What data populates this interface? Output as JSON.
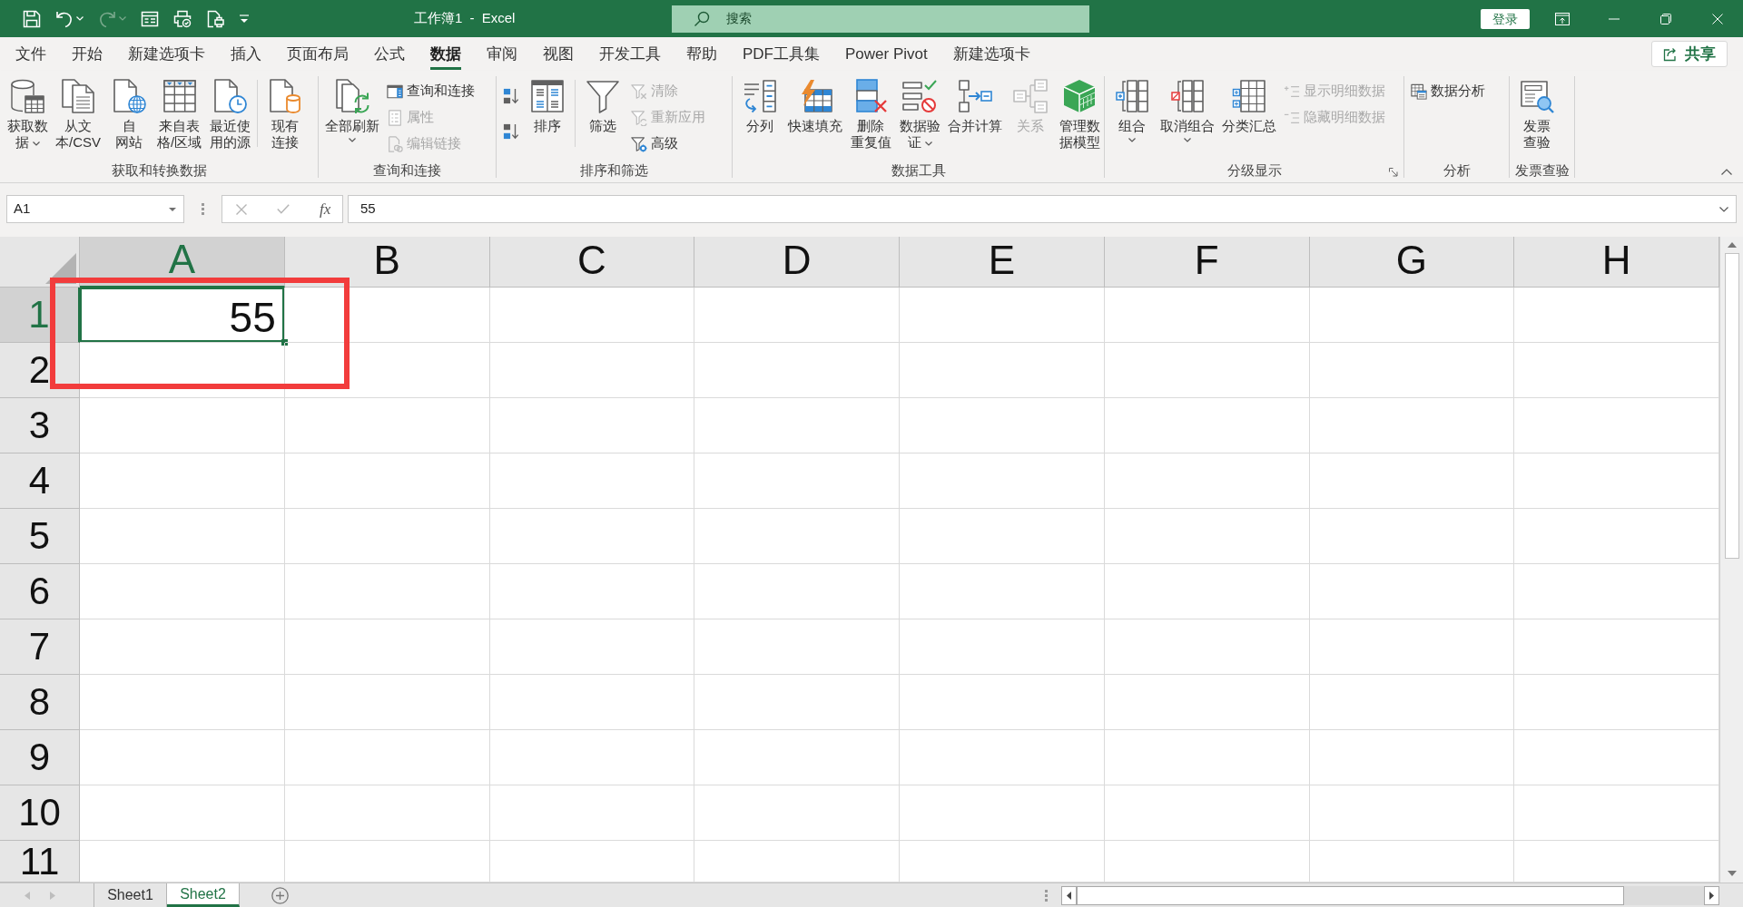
{
  "title_bar": {
    "quick_access": [
      {
        "kind": "save",
        "disabled": false
      },
      {
        "kind": "undo",
        "disabled": false,
        "dropdown": true
      },
      {
        "kind": "redo",
        "disabled": true,
        "dropdown": true
      },
      {
        "kind": "form",
        "disabled": false
      },
      {
        "kind": "print",
        "disabled": false
      },
      {
        "kind": "preview",
        "disabled": false
      },
      {
        "kind": "customize",
        "disabled": false
      }
    ],
    "title": "工作簿1 - Excel",
    "search": {
      "placeholder": "搜索"
    },
    "login_button": "登录"
  },
  "menu_tabs": [
    {
      "label": "文件",
      "selected": false
    },
    {
      "label": "开始",
      "selected": false
    },
    {
      "label": "新建选项卡",
      "selected": false
    },
    {
      "label": "插入",
      "selected": false
    },
    {
      "label": "页面布局",
      "selected": false
    },
    {
      "label": "公式",
      "selected": false
    },
    {
      "label": "数据",
      "selected": true
    },
    {
      "label": "审阅",
      "selected": false
    },
    {
      "label": "视图",
      "selected": false
    },
    {
      "label": "开发工具",
      "selected": false
    },
    {
      "label": "帮助",
      "selected": false
    },
    {
      "label": "PDF工具集",
      "selected": false
    },
    {
      "label": "Power Pivot",
      "selected": false
    },
    {
      "label": "新建选项卡",
      "selected": false
    }
  ],
  "share_button": "共享",
  "ribbon": {
    "groups": [
      {
        "title": "获取和转换数据",
        "items": [
          {
            "kind": "large",
            "label": "获取数据",
            "dropdown": true,
            "disabled": false
          },
          {
            "kind": "large",
            "label": "从文本/CSV",
            "disabled": false
          },
          {
            "kind": "large",
            "label": "自网站",
            "disabled": false
          },
          {
            "kind": "large",
            "label": "来自表格/区域",
            "disabled": false
          },
          {
            "kind": "large",
            "label": "最近使用的源",
            "disabled": false
          },
          {
            "kind": "separator"
          },
          {
            "kind": "large",
            "label": "现有连接",
            "disabled": false
          }
        ]
      },
      {
        "title": "查询和连接",
        "items": [
          {
            "kind": "large",
            "label": "全部刷新",
            "dropdown": true,
            "disabled": false
          },
          {
            "kind": "stack",
            "items": [
              {
                "label": "查询和连接",
                "disabled": false
              },
              {
                "label": "属性",
                "disabled": true
              },
              {
                "label": "编辑链接",
                "disabled": true
              }
            ]
          }
        ]
      },
      {
        "title": "排序和筛选",
        "items": [
          {
            "kind": "stack",
            "items": [
              {
                "disabled": false
              },
              {
                "disabled": false
              }
            ]
          },
          {
            "kind": "large",
            "label": "排序",
            "disabled": false
          },
          {
            "kind": "separator"
          },
          {
            "kind": "large",
            "label": "筛选",
            "disabled": false
          },
          {
            "kind": "stack",
            "items": [
              {
                "label": "清除",
                "disabled": true
              },
              {
                "label": "重新应用",
                "disabled": true
              },
              {
                "label": "高级",
                "disabled": false
              }
            ]
          }
        ]
      },
      {
        "title": "数据工具",
        "items": [
          {
            "kind": "large",
            "label": "分列",
            "disabled": false
          },
          {
            "kind": "large",
            "label": "快速填充",
            "disabled": false
          },
          {
            "kind": "large",
            "label": "删除重复值",
            "disabled": false
          },
          {
            "kind": "large",
            "label": "数据验证",
            "dropdown": true,
            "disabled": false
          },
          {
            "kind": "large",
            "label": "合并计算",
            "disabled": false
          },
          {
            "kind": "large",
            "label": "关系",
            "disabled": true
          },
          {
            "kind": "large",
            "label": "管理数据模型",
            "disabled": false
          }
        ]
      },
      {
        "title": "分级显示",
        "launcher": true,
        "items": [
          {
            "kind": "large",
            "label": "组合",
            "dropdown": true,
            "disabled": false
          },
          {
            "kind": "large",
            "label": "取消组合",
            "dropdown": true,
            "disabled": false
          },
          {
            "kind": "large",
            "label": "分类汇总",
            "disabled": false
          },
          {
            "kind": "stack",
            "items": [
              {
                "label": "显示明细数据",
                "disabled": true
              },
              {
                "label": "隐藏明细数据",
                "disabled": true
              }
            ]
          }
        ]
      },
      {
        "title": "分析",
        "items": [
          {
            "kind": "stack",
            "items": [
              {
                "label": "数据分析",
                "disabled": false
              }
            ]
          }
        ]
      },
      {
        "title": "发票查验",
        "items": [
          {
            "kind": "large",
            "label": "发票查验",
            "disabled": false
          }
        ]
      }
    ]
  },
  "formula_bar": {
    "name_box": "A1",
    "function_button": "fx",
    "formula": "55"
  },
  "sheet": {
    "columns": [
      {
        "label": "A",
        "selected": true
      },
      {
        "label": "B",
        "selected": false
      },
      {
        "label": "C",
        "selected": false
      },
      {
        "label": "D",
        "selected": false
      },
      {
        "label": "E",
        "selected": false
      },
      {
        "label": "F",
        "selected": false
      },
      {
        "label": "G",
        "selected": false
      },
      {
        "label": "H",
        "selected": false
      }
    ],
    "rows": [
      {
        "label": "1",
        "selected": true,
        "values": [
          "55"
        ]
      },
      {
        "label": "2",
        "selected": false
      },
      {
        "label": "3",
        "selected": false
      },
      {
        "label": "4",
        "selected": false
      },
      {
        "label": "5",
        "selected": false
      },
      {
        "label": "6",
        "selected": false
      },
      {
        "label": "7",
        "selected": false
      },
      {
        "label": "8",
        "selected": false
      },
      {
        "label": "9",
        "selected": false
      },
      {
        "label": "10",
        "selected": false
      },
      {
        "label": "11",
        "selected": false
      }
    ]
  },
  "sheet_tabs": [
    {
      "label": "Sheet1",
      "selected": false
    },
    {
      "label": "Sheet2",
      "selected": true
    }
  ]
}
